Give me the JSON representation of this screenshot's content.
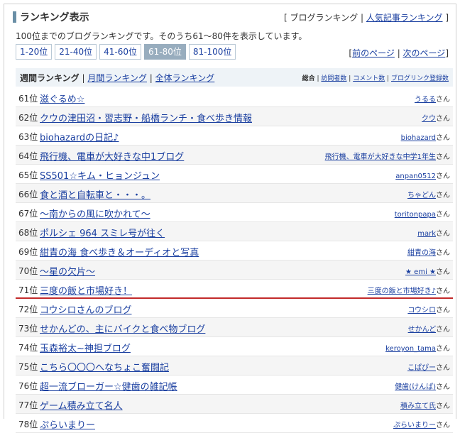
{
  "header": {
    "title": "ランキング表示",
    "links_prefix": "[ ",
    "link_blog": "ブログランキング",
    "sep": " | ",
    "link_popular": "人気記事ランキング",
    "links_suffix": " ]"
  },
  "description": "100位までのブログランキングです。そのうち61～80件を表示しています。",
  "ranges": [
    "1-20位",
    "21-40位",
    "41-60位",
    "61-80位",
    "81-100位"
  ],
  "active_range": "61-80位",
  "pager": {
    "open": "[",
    "prev": "前のページ",
    "sep": " | ",
    "next": "次のページ",
    "close": "]"
  },
  "tabs": {
    "weekly": "週間ランキング",
    "sep1": " | ",
    "monthly": "月間ランキング",
    "sep2": " | ",
    "overall": "全体ランキング",
    "sort_total": "総合",
    "sort_sep1": " | ",
    "sort_visits": "訪問者数",
    "sort_sep2": " | ",
    "sort_comments": "コメント数",
    "sort_sep3": " | ",
    "sort_links": "ブログリンク登録数"
  },
  "rows": [
    {
      "rank": "61位",
      "title": "滋ぐるめ☆",
      "owner": "うるる",
      "suffix": "さん"
    },
    {
      "rank": "62位",
      "title": "クウの津田沼・習志野・船橋ランチ・食べ歩き情報",
      "owner": "クウ",
      "suffix": "さん"
    },
    {
      "rank": "63位",
      "title": "biohazardの日記♪",
      "owner": "biohazard",
      "suffix": "さん"
    },
    {
      "rank": "64位",
      "title": "飛行機、電車が大好きな中1ブログ",
      "owner": "飛行機、電車が大好きな中学1年生",
      "suffix": "さん"
    },
    {
      "rank": "65位",
      "title": "SS501☆キム・ヒョンジュン",
      "owner": "anpan0512",
      "suffix": "さん"
    },
    {
      "rank": "66位",
      "title": "食と酒と自転車と・・・。",
      "owner": "ちゃどん",
      "suffix": "さん"
    },
    {
      "rank": "67位",
      "title": "～南からの風に吹かれて～",
      "owner": "toritonpapa",
      "suffix": "さん"
    },
    {
      "rank": "68位",
      "title": "ポルシェ 964 スミレ号が往く",
      "owner": "mark",
      "suffix": "さん"
    },
    {
      "rank": "69位",
      "title": "紺青の海 食べ歩き＆オーディオと写真",
      "owner": "紺青の海",
      "suffix": "さん"
    },
    {
      "rank": "70位",
      "title": "～星の欠片～",
      "owner": "★ emi ★",
      "suffix": "さん"
    },
    {
      "rank": "71位",
      "title": "三度の飯と市場好き！",
      "owner": "三度の飯と市場好き♪",
      "suffix": "さん"
    },
    {
      "rank": "72位",
      "title": "コウシロさんのブログ",
      "owner": "コウシロ",
      "suffix": "さん"
    },
    {
      "rank": "73位",
      "title": "せかんどの、主にバイクと食べ物ブログ",
      "owner": "せかんど",
      "suffix": "さん"
    },
    {
      "rank": "74位",
      "title": "玉森裕太~神担ブログ",
      "owner": "keroyon_tama",
      "suffix": "さん"
    },
    {
      "rank": "75位",
      "title": "こちら〇〇〇へなちょこ奮闘記",
      "owner": "こぱぴー",
      "suffix": "さん"
    },
    {
      "rank": "76位",
      "title": "超一流ブローガー☆健歯の雑記帳",
      "owner": "健歯(けんぱ)",
      "suffix": "さん"
    },
    {
      "rank": "77位",
      "title": "ゲーム積み立て名人",
      "owner": "積み立て氏",
      "suffix": "さん"
    },
    {
      "rank": "78位",
      "title": "ぷらいまりー",
      "owner": "ぷらいまりー",
      "suffix": "さん"
    }
  ],
  "highlighted_row": "71位",
  "colors": {
    "link": "#1a3fa0",
    "active_range_bg": "#98adbe",
    "title_accent": "#6a8fa6",
    "highlight_line": "#c22a2a"
  }
}
